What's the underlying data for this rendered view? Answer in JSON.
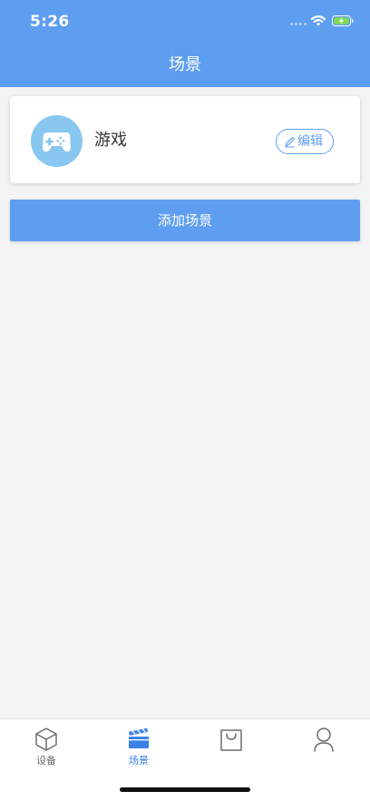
{
  "status_bar": {
    "time": "5:26",
    "icons": [
      "signal-icon",
      "wifi-icon",
      "battery-charging-icon"
    ]
  },
  "header": {
    "title": "场景"
  },
  "scene_card": {
    "name": "游戏",
    "icon": "gamepad-icon",
    "edit_label": "编辑",
    "edit_icon": "pencil-icon"
  },
  "add_scene_button": {
    "label": "添加场景"
  },
  "tab_bar": {
    "tabs": [
      {
        "label": "设备",
        "icon": "cube-icon",
        "active": false
      },
      {
        "label": "场景",
        "icon": "clapperboard-icon",
        "active": true
      },
      {
        "label": "",
        "icon": "shopping-bag-icon",
        "active": false
      },
      {
        "label": "",
        "icon": "user-icon",
        "active": false
      }
    ]
  },
  "colors": {
    "primary": "#5e9ef0",
    "active_tab": "#3b82e8",
    "avatar_bg": "#88c7f0",
    "page_bg": "#f3f3f3"
  }
}
